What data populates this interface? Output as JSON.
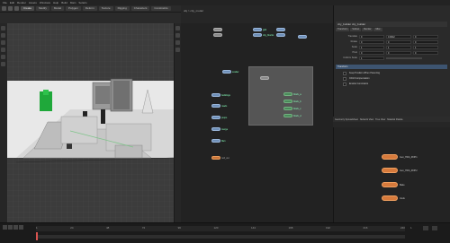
{
  "menu": [
    "File",
    "Edit",
    "Render",
    "Assets",
    "Windows",
    "Help",
    "Build",
    "Main",
    "Solaris"
  ],
  "toolbar": {
    "tabs": [
      "Create",
      "Modify",
      "Model",
      "Polygon",
      "Deform",
      "Texture",
      "Rigging",
      "Characters",
      "Constraints",
      "Hair Utils",
      "Guide Process"
    ]
  },
  "network": {
    "path": "obj > city_model",
    "nodes_left": [
      "",
      ""
    ],
    "node_labels": [
      "grid",
      "city_blocks",
      "scatter",
      "buildings",
      "roads",
      "props",
      "merge",
      "file1",
      "null_out"
    ],
    "inner_labels": [
      "block_a",
      "block_b",
      "block_c",
      "block_d"
    ]
  },
  "params": {
    "title": "city_builder  city_builder",
    "tabs": [
      "Transform",
      "Subnet",
      "Render",
      "Misc"
    ],
    "rows": [
      {
        "label": "Translate",
        "v1": "0",
        "v2": "0.0012",
        "v3": "0"
      },
      {
        "label": "Rotate",
        "v1": "0",
        "v2": "0",
        "v3": "0"
      },
      {
        "label": "Scale",
        "v1": "1",
        "v2": "1",
        "v3": "1"
      },
      {
        "label": "Pivot",
        "v1": "0",
        "v2": "0",
        "v3": "0"
      },
      {
        "label": "Uniform Scale",
        "v1": "1",
        "v2": "",
        "": ""
      }
    ],
    "section": "Transform",
    "checks": [
      "Keep Position When Parenting",
      "Child Compensation",
      "Enable Constraints"
    ]
  },
  "lower_network": {
    "tabs": [
      "Geometry Spreadsheet",
      "Network View",
      "Tree View",
      "Material Palette",
      "Asset Browser"
    ],
    "nodes": [
      "Gen_HDA_ROP1",
      "Gen_HDA_ROP2",
      "Bake",
      "Cook"
    ]
  },
  "timeline": {
    "frames": [
      "1",
      "24",
      "48",
      "72",
      "96",
      "120",
      "144",
      "168",
      "192",
      "216",
      "240"
    ],
    "current": "1"
  },
  "colors": {
    "accent": "#6e8fb8",
    "node_orange": "#d67a3c",
    "node_green": "#4a8a5a"
  }
}
